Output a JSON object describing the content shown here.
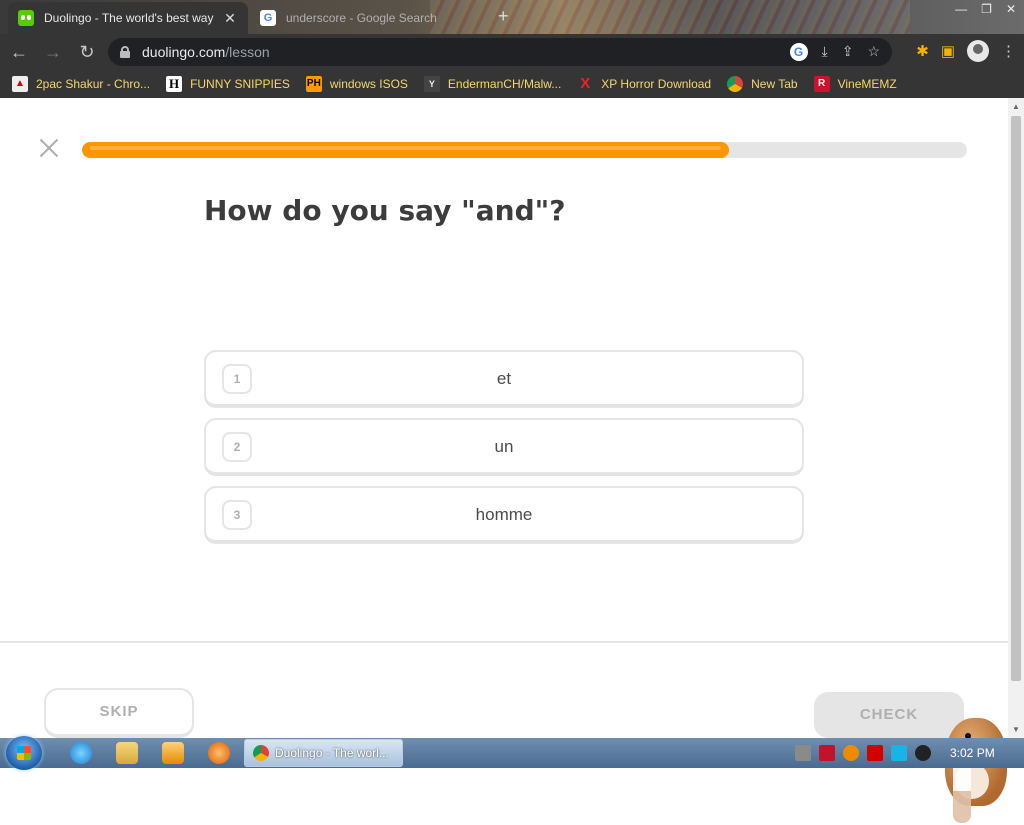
{
  "browser": {
    "tabs": [
      {
        "title": "Duolingo - The world's best way",
        "active": true
      },
      {
        "title": "underscore - Google Search",
        "active": false
      }
    ],
    "url_host": "duolingo.com",
    "url_path": "/lesson"
  },
  "bookmarks": [
    {
      "label": "2pac Shakur - Chro...",
      "icon": "2pac-icon"
    },
    {
      "label": "FUNNY SNIPPIES",
      "icon": "h-icon"
    },
    {
      "label": "windows ISOS",
      "icon": "ph-icon"
    },
    {
      "label": "EndermanCH/Malw...",
      "icon": "youtube-icon"
    },
    {
      "label": "XP Horror Download",
      "icon": "x-icon"
    },
    {
      "label": "New Tab",
      "icon": "chrome-icon"
    },
    {
      "label": "VineMEMZ",
      "icon": "r-icon"
    }
  ],
  "lesson": {
    "progress_fraction": 0.731,
    "question": "How do you say \"and\"?",
    "choices": [
      {
        "number": "1",
        "text": "et"
      },
      {
        "number": "2",
        "text": "un"
      },
      {
        "number": "3",
        "text": "homme"
      }
    ],
    "skip_label": "SKIP",
    "check_label": "CHECK"
  },
  "taskbar": {
    "chrome_window_label": "Duolingo - The worl...",
    "clock": "3:02 PM"
  },
  "colors": {
    "progress": "#ff9600",
    "text": "#3c3c3c",
    "border": "#e5e5e5"
  }
}
